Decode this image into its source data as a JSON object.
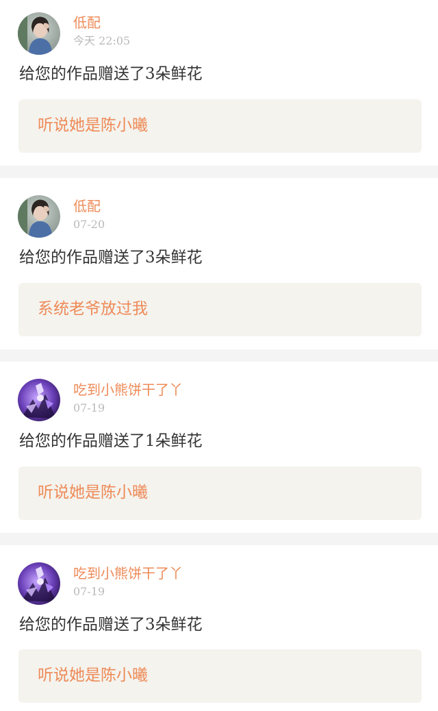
{
  "notifications": [
    {
      "user": "低配",
      "time": "今天 22:05",
      "action": "给您的作品赠送了3朵鲜花",
      "work_title": "听说她是陈小曦",
      "avatar_icon": "user-photo-avatar-icon"
    },
    {
      "user": "低配",
      "time": "07-20",
      "action": "给您的作品赠送了3朵鲜花",
      "work_title": "系统老爷放过我",
      "avatar_icon": "user-photo-avatar-icon"
    },
    {
      "user": "吃到小熊饼干了丫",
      "time": "07-19",
      "action": "给您的作品赠送了1朵鲜花",
      "work_title": "听说她是陈小曦",
      "avatar_icon": "anime-character-avatar-icon"
    },
    {
      "user": "吃到小熊饼干了丫",
      "time": "07-19",
      "action": "给您的作品赠送了3朵鲜花",
      "work_title": "听说她是陈小曦",
      "avatar_icon": "anime-character-avatar-icon"
    }
  ],
  "colors": {
    "accent": "#ee8a57",
    "text": "#333333",
    "muted": "#b9b9b9",
    "box": "#f4f3ee",
    "separator": "#f4f4f4"
  }
}
